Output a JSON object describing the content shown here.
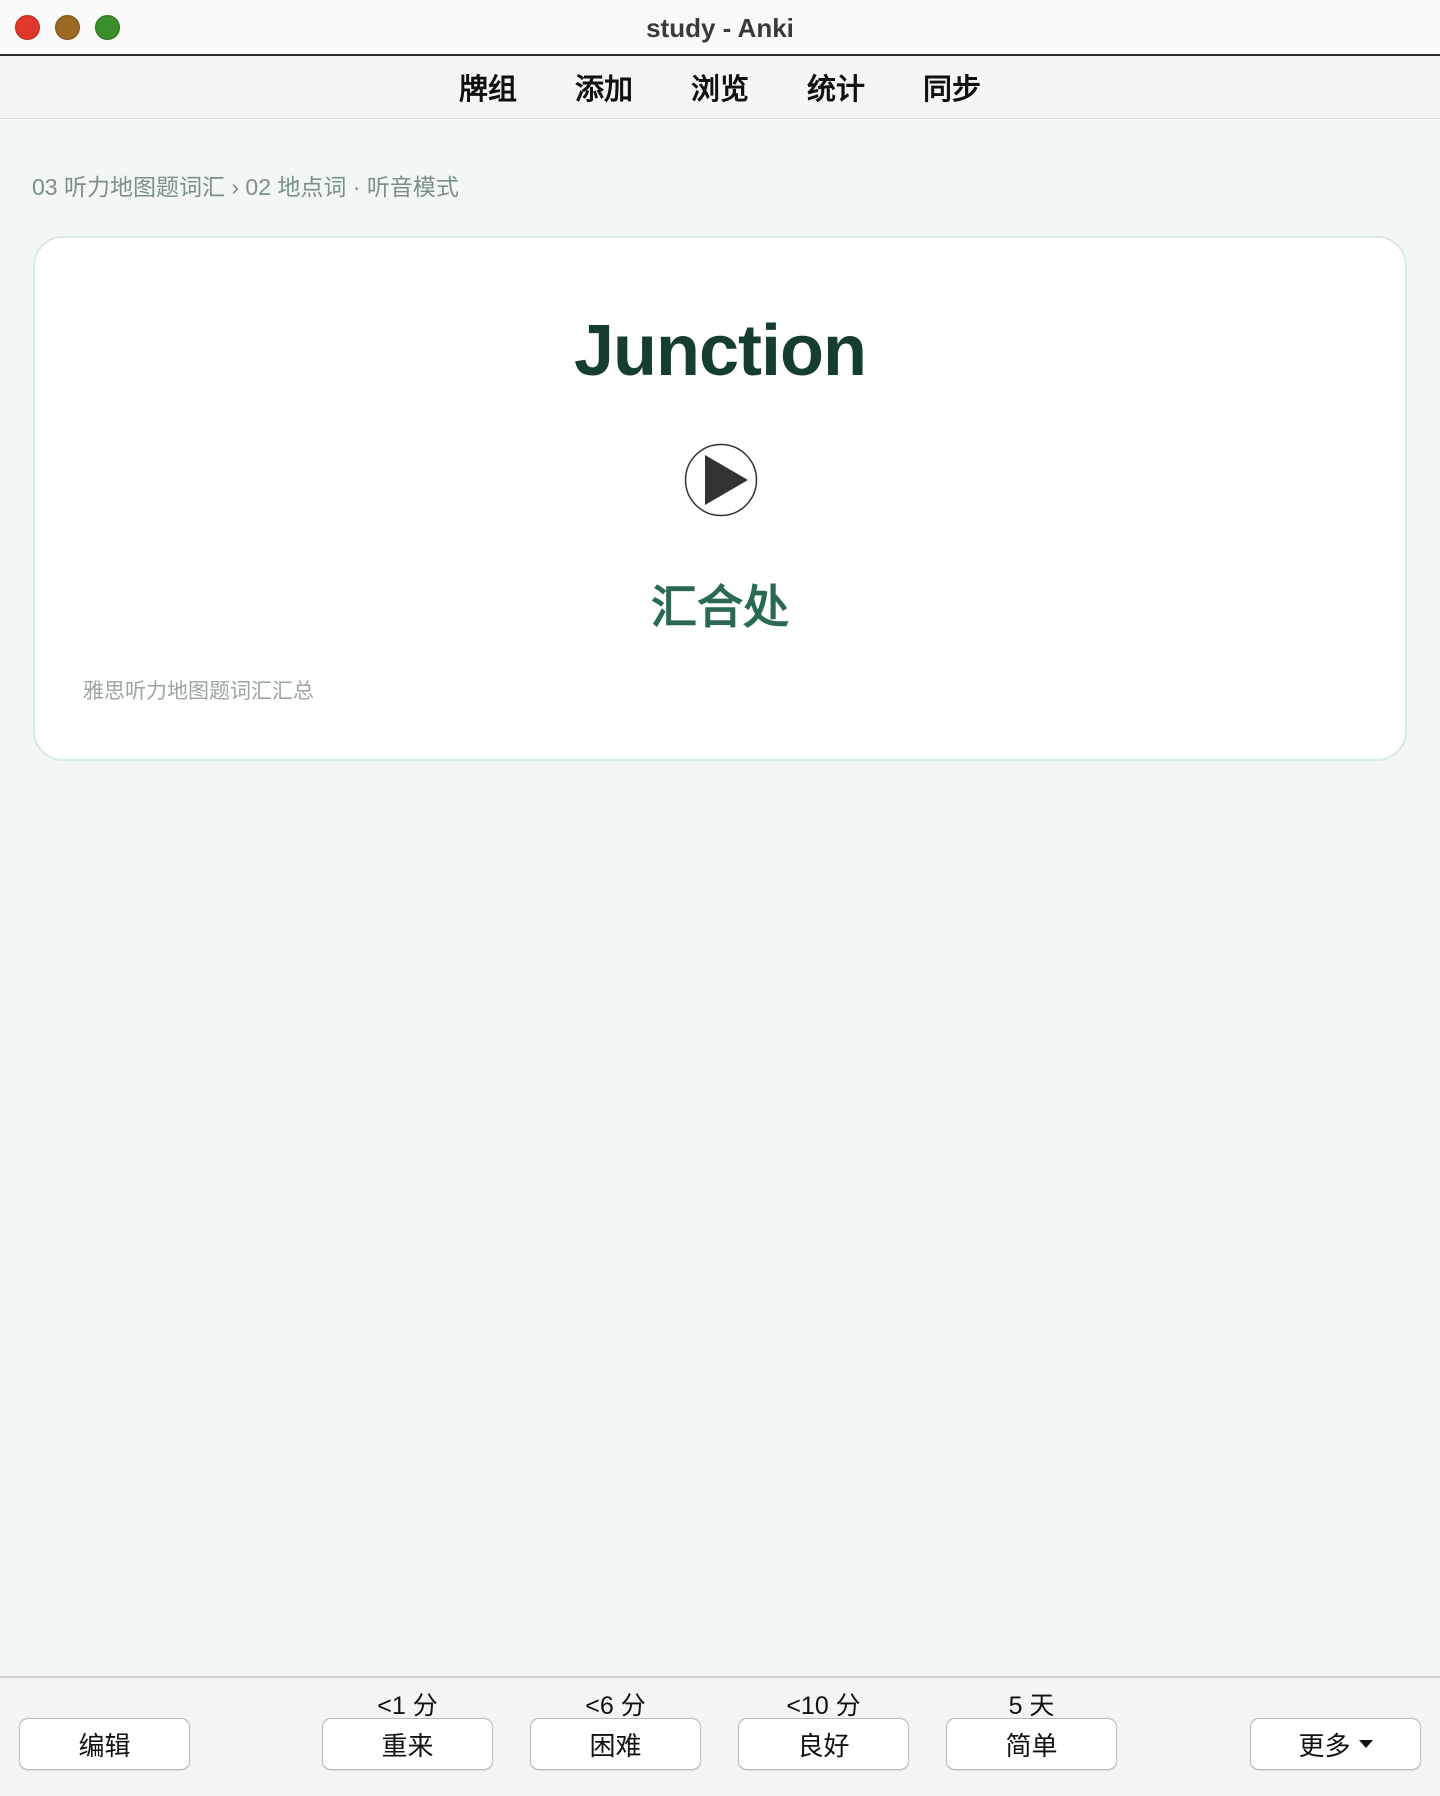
{
  "window": {
    "title": "study - Anki"
  },
  "toolbar": {
    "items": [
      "牌组",
      "添加",
      "浏览",
      "统计",
      "同步"
    ]
  },
  "breadcrumb": "03 听力地图题词汇 › 02 地点词 · 听音模式",
  "card": {
    "word": "Junction",
    "meaning": "汇合处",
    "source": "雅思听力地图题词汇汇总"
  },
  "answer": {
    "edit_label": "编辑",
    "more_label": "更多",
    "buttons": [
      {
        "label": "重来",
        "interval": "<1 分"
      },
      {
        "label": "困难",
        "interval": "<6 分"
      },
      {
        "label": "良好",
        "interval": "<10 分"
      },
      {
        "label": "简单",
        "interval": "5 天"
      }
    ]
  },
  "colors": {
    "word": "#163d31",
    "meaning": "#2a6a51",
    "content_bg": "#f2f7f6",
    "card_border": "#d6ebe6"
  },
  "icons": {
    "play": "play-circle-icon",
    "more": "chevron-down-icon"
  }
}
